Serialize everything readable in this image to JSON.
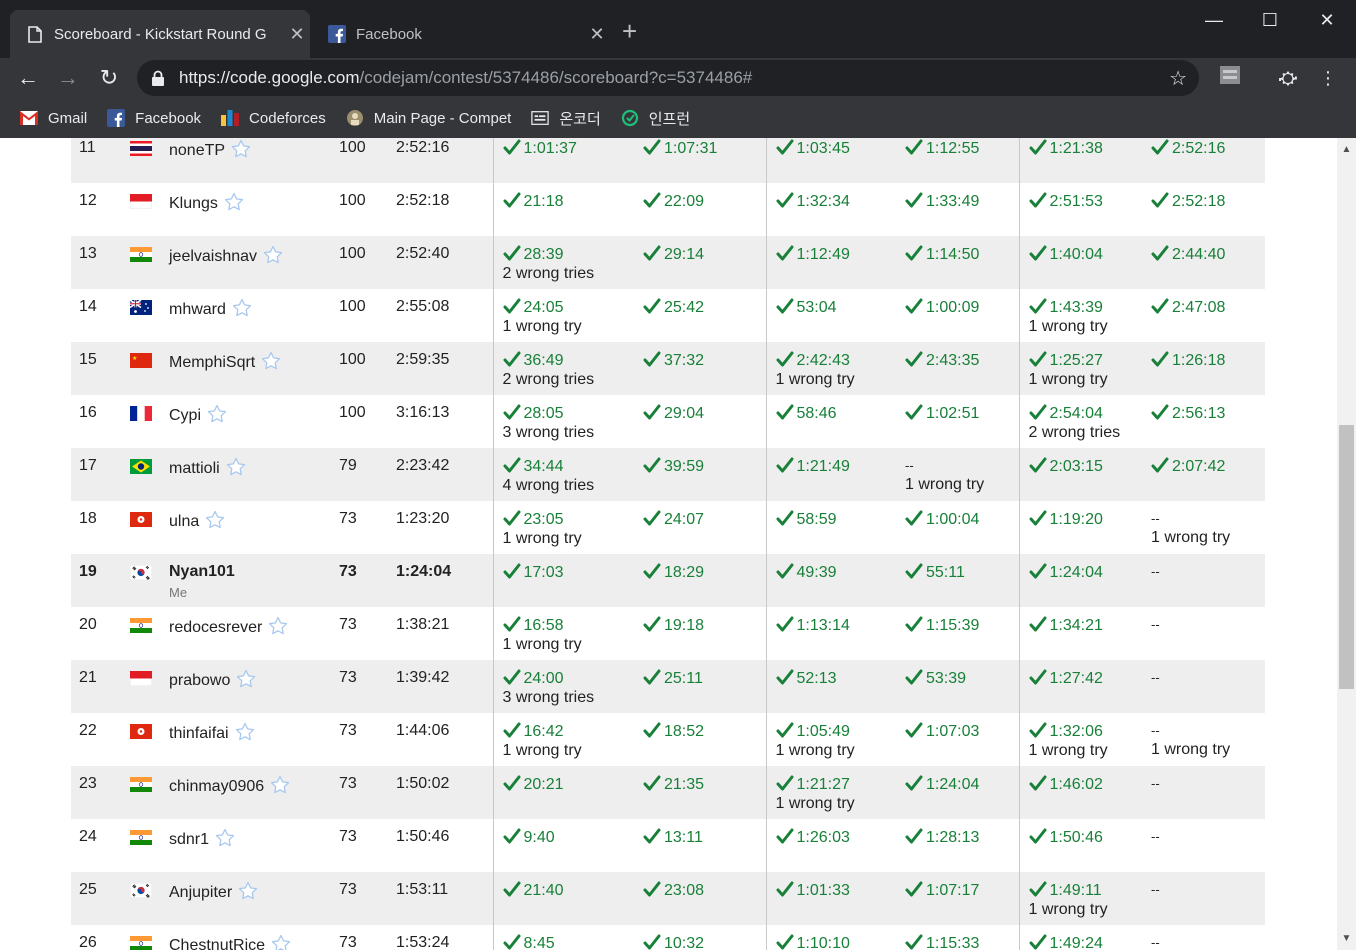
{
  "browser": {
    "tabs": [
      {
        "title": "Scoreboard - Kickstart Round G",
        "active": true,
        "icon": "page-icon"
      },
      {
        "title": "Facebook",
        "active": false,
        "icon": "facebook-icon"
      }
    ],
    "url_host": "https://code.google.com",
    "url_path": "/codejam/contest/5374486/scoreboard?c=5374486#",
    "bookmarks": [
      {
        "label": "Gmail",
        "icon": "gmail-icon"
      },
      {
        "label": "Facebook",
        "icon": "facebook-icon"
      },
      {
        "label": "Codeforces",
        "icon": "codeforces-icon"
      },
      {
        "label": "Main Page - Compet",
        "icon": "wiki-icon"
      },
      {
        "label": "온코더",
        "icon": "oncoder-icon"
      },
      {
        "label": "인프런",
        "icon": "inflearn-icon"
      }
    ]
  },
  "scoreboard": {
    "me_label": "Me",
    "rows": [
      {
        "rank": "11",
        "flag": "th",
        "name": "noneTP",
        "score": "100",
        "penalty": "2:52:16",
        "problems": [
          {
            "time": "1:01:37",
            "wrong": ""
          },
          {
            "time": "1:07:31",
            "wrong": ""
          },
          {
            "time": "1:03:45",
            "wrong": ""
          },
          {
            "time": "1:12:55",
            "wrong": ""
          },
          {
            "time": "1:21:38",
            "wrong": ""
          },
          {
            "time": "2:52:16",
            "wrong": ""
          }
        ]
      },
      {
        "rank": "12",
        "flag": "id",
        "name": "Klungs",
        "score": "100",
        "penalty": "2:52:18",
        "problems": [
          {
            "time": "21:18",
            "wrong": ""
          },
          {
            "time": "22:09",
            "wrong": ""
          },
          {
            "time": "1:32:34",
            "wrong": ""
          },
          {
            "time": "1:33:49",
            "wrong": ""
          },
          {
            "time": "2:51:53",
            "wrong": ""
          },
          {
            "time": "2:52:18",
            "wrong": ""
          }
        ]
      },
      {
        "rank": "13",
        "flag": "in",
        "name": "jeelvaishnav",
        "score": "100",
        "penalty": "2:52:40",
        "problems": [
          {
            "time": "28:39",
            "wrong": "2 wrong tries"
          },
          {
            "time": "29:14",
            "wrong": ""
          },
          {
            "time": "1:12:49",
            "wrong": ""
          },
          {
            "time": "1:14:50",
            "wrong": ""
          },
          {
            "time": "1:40:04",
            "wrong": ""
          },
          {
            "time": "2:44:40",
            "wrong": ""
          }
        ]
      },
      {
        "rank": "14",
        "flag": "au",
        "name": "mhward",
        "score": "100",
        "penalty": "2:55:08",
        "problems": [
          {
            "time": "24:05",
            "wrong": "1 wrong try"
          },
          {
            "time": "25:42",
            "wrong": ""
          },
          {
            "time": "53:04",
            "wrong": ""
          },
          {
            "time": "1:00:09",
            "wrong": ""
          },
          {
            "time": "1:43:39",
            "wrong": "1 wrong try"
          },
          {
            "time": "2:47:08",
            "wrong": ""
          }
        ]
      },
      {
        "rank": "15",
        "flag": "cn",
        "name": "MemphiSqrt",
        "score": "100",
        "penalty": "2:59:35",
        "problems": [
          {
            "time": "36:49",
            "wrong": "2 wrong tries"
          },
          {
            "time": "37:32",
            "wrong": ""
          },
          {
            "time": "2:42:43",
            "wrong": "1 wrong try"
          },
          {
            "time": "2:43:35",
            "wrong": ""
          },
          {
            "time": "1:25:27",
            "wrong": "1 wrong try"
          },
          {
            "time": "1:26:18",
            "wrong": ""
          }
        ]
      },
      {
        "rank": "16",
        "flag": "fr",
        "name": "Cypi",
        "score": "100",
        "penalty": "3:16:13",
        "problems": [
          {
            "time": "28:05",
            "wrong": "3 wrong tries"
          },
          {
            "time": "29:04",
            "wrong": ""
          },
          {
            "time": "58:46",
            "wrong": ""
          },
          {
            "time": "1:02:51",
            "wrong": ""
          },
          {
            "time": "2:54:04",
            "wrong": "2 wrong tries"
          },
          {
            "time": "2:56:13",
            "wrong": ""
          }
        ]
      },
      {
        "rank": "17",
        "flag": "br",
        "name": "mattioli",
        "score": "79",
        "penalty": "2:23:42",
        "problems": [
          {
            "time": "34:44",
            "wrong": "4 wrong tries"
          },
          {
            "time": "39:59",
            "wrong": ""
          },
          {
            "time": "1:21:49",
            "wrong": ""
          },
          {
            "time": "--",
            "wrong": "1 wrong try"
          },
          {
            "time": "2:03:15",
            "wrong": ""
          },
          {
            "time": "2:07:42",
            "wrong": ""
          }
        ]
      },
      {
        "rank": "18",
        "flag": "hk",
        "name": "ulna",
        "score": "73",
        "penalty": "1:23:20",
        "problems": [
          {
            "time": "23:05",
            "wrong": "1 wrong try"
          },
          {
            "time": "24:07",
            "wrong": ""
          },
          {
            "time": "58:59",
            "wrong": ""
          },
          {
            "time": "1:00:04",
            "wrong": ""
          },
          {
            "time": "1:19:20",
            "wrong": ""
          },
          {
            "time": "--",
            "wrong": "1 wrong try"
          }
        ]
      },
      {
        "rank": "19",
        "flag": "kr",
        "name": "Nyan101",
        "score": "73",
        "penalty": "1:24:04",
        "me": true,
        "problems": [
          {
            "time": "17:03",
            "wrong": ""
          },
          {
            "time": "18:29",
            "wrong": ""
          },
          {
            "time": "49:39",
            "wrong": ""
          },
          {
            "time": "55:11",
            "wrong": ""
          },
          {
            "time": "1:24:04",
            "wrong": ""
          },
          {
            "time": "--",
            "wrong": ""
          }
        ]
      },
      {
        "rank": "20",
        "flag": "in",
        "name": "redocesrever",
        "score": "73",
        "penalty": "1:38:21",
        "problems": [
          {
            "time": "16:58",
            "wrong": "1 wrong try"
          },
          {
            "time": "19:18",
            "wrong": ""
          },
          {
            "time": "1:13:14",
            "wrong": ""
          },
          {
            "time": "1:15:39",
            "wrong": ""
          },
          {
            "time": "1:34:21",
            "wrong": ""
          },
          {
            "time": "--",
            "wrong": ""
          }
        ]
      },
      {
        "rank": "21",
        "flag": "id",
        "name": "prabowo",
        "score": "73",
        "penalty": "1:39:42",
        "problems": [
          {
            "time": "24:00",
            "wrong": "3 wrong tries"
          },
          {
            "time": "25:11",
            "wrong": ""
          },
          {
            "time": "52:13",
            "wrong": ""
          },
          {
            "time": "53:39",
            "wrong": ""
          },
          {
            "time": "1:27:42",
            "wrong": ""
          },
          {
            "time": "--",
            "wrong": ""
          }
        ]
      },
      {
        "rank": "22",
        "flag": "hk",
        "name": "thinfaifai",
        "score": "73",
        "penalty": "1:44:06",
        "problems": [
          {
            "time": "16:42",
            "wrong": "1 wrong try"
          },
          {
            "time": "18:52",
            "wrong": ""
          },
          {
            "time": "1:05:49",
            "wrong": "1 wrong try"
          },
          {
            "time": "1:07:03",
            "wrong": ""
          },
          {
            "time": "1:32:06",
            "wrong": "1 wrong try"
          },
          {
            "time": "--",
            "wrong": "1 wrong try"
          }
        ]
      },
      {
        "rank": "23",
        "flag": "in",
        "name": "chinmay0906",
        "score": "73",
        "penalty": "1:50:02",
        "problems": [
          {
            "time": "20:21",
            "wrong": ""
          },
          {
            "time": "21:35",
            "wrong": ""
          },
          {
            "time": "1:21:27",
            "wrong": "1 wrong try"
          },
          {
            "time": "1:24:04",
            "wrong": ""
          },
          {
            "time": "1:46:02",
            "wrong": ""
          },
          {
            "time": "--",
            "wrong": ""
          }
        ]
      },
      {
        "rank": "24",
        "flag": "in",
        "name": "sdnr1",
        "score": "73",
        "penalty": "1:50:46",
        "problems": [
          {
            "time": "9:40",
            "wrong": ""
          },
          {
            "time": "13:11",
            "wrong": ""
          },
          {
            "time": "1:26:03",
            "wrong": ""
          },
          {
            "time": "1:28:13",
            "wrong": ""
          },
          {
            "time": "1:50:46",
            "wrong": ""
          },
          {
            "time": "--",
            "wrong": ""
          }
        ]
      },
      {
        "rank": "25",
        "flag": "kr",
        "name": "Anjupiter",
        "score": "73",
        "penalty": "1:53:11",
        "problems": [
          {
            "time": "21:40",
            "wrong": ""
          },
          {
            "time": "23:08",
            "wrong": ""
          },
          {
            "time": "1:01:33",
            "wrong": ""
          },
          {
            "time": "1:07:17",
            "wrong": ""
          },
          {
            "time": "1:49:11",
            "wrong": "1 wrong try"
          },
          {
            "time": "--",
            "wrong": ""
          }
        ]
      },
      {
        "rank": "26",
        "flag": "in",
        "name": "ChestnutRice",
        "score": "73",
        "penalty": "1:53:24",
        "problems": [
          {
            "time": "8:45",
            "wrong": ""
          },
          {
            "time": "10:32",
            "wrong": ""
          },
          {
            "time": "1:10:10",
            "wrong": ""
          },
          {
            "time": "1:15:33",
            "wrong": ""
          },
          {
            "time": "1:49:24",
            "wrong": ""
          },
          {
            "time": "--",
            "wrong": ""
          }
        ]
      }
    ]
  }
}
